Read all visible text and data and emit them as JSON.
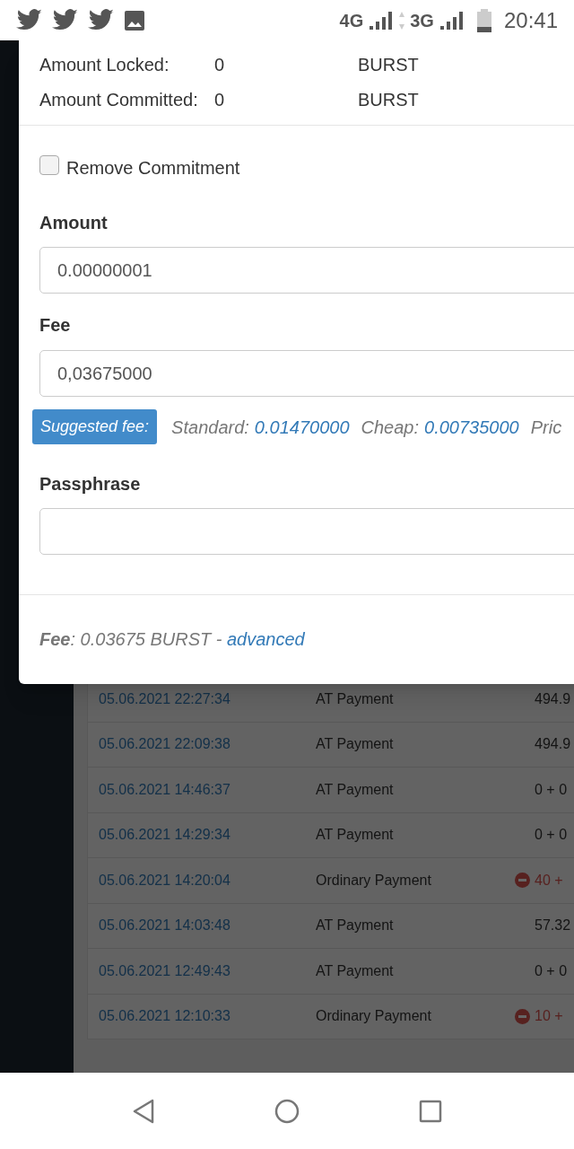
{
  "status_bar": {
    "network_1": "4G",
    "network_2": "3G",
    "time": "20:41"
  },
  "balance_rows": [
    {
      "label": "Amount Locked:",
      "value": "0",
      "unit": "BURST"
    },
    {
      "label": "Amount Committed:",
      "value": "0",
      "unit": "BURST"
    }
  ],
  "remove_commitment": {
    "label": "Remove Commitment",
    "checked": false
  },
  "amount": {
    "label": "Amount",
    "value": "0.00000001"
  },
  "fee": {
    "label": "Fee",
    "value": "0,03675000"
  },
  "suggested_fee": {
    "badge": "Suggested fee:",
    "options": [
      {
        "label": "Standard:",
        "value": "0.01470000"
      },
      {
        "label": "Cheap:",
        "value": "0.00735000"
      },
      {
        "label": "Pric"
      }
    ]
  },
  "passphrase": {
    "label": "Passphrase"
  },
  "footer": {
    "text": "**Fee**: 0.03675 BURST -",
    "link": "advanced"
  },
  "transactions": [
    {
      "date": "05.06.2021 22:27:34",
      "type": "AT Payment",
      "amount": "494.9",
      "outgoing": false
    },
    {
      "date": "05.06.2021 22:09:38",
      "type": "AT Payment",
      "amount": "494.9",
      "outgoing": false
    },
    {
      "date": "05.06.2021 14:46:37",
      "type": "AT Payment",
      "amount": "0 + 0",
      "outgoing": false
    },
    {
      "date": "05.06.2021 14:29:34",
      "type": "AT Payment",
      "amount": "0 + 0",
      "outgoing": false
    },
    {
      "date": "05.06.2021 14:20:04",
      "type": "Ordinary Payment",
      "amount": "40 +",
      "outgoing": true
    },
    {
      "date": "05.06.2021 14:03:48",
      "type": "AT Payment",
      "amount": "57.32",
      "outgoing": false
    },
    {
      "date": "05.06.2021 12:49:43",
      "type": "AT Payment",
      "amount": "0 + 0",
      "outgoing": false
    },
    {
      "date": "05.06.2021 12:10:33",
      "type": "Ordinary Payment",
      "amount": "10 +",
      "outgoing": true
    }
  ]
}
